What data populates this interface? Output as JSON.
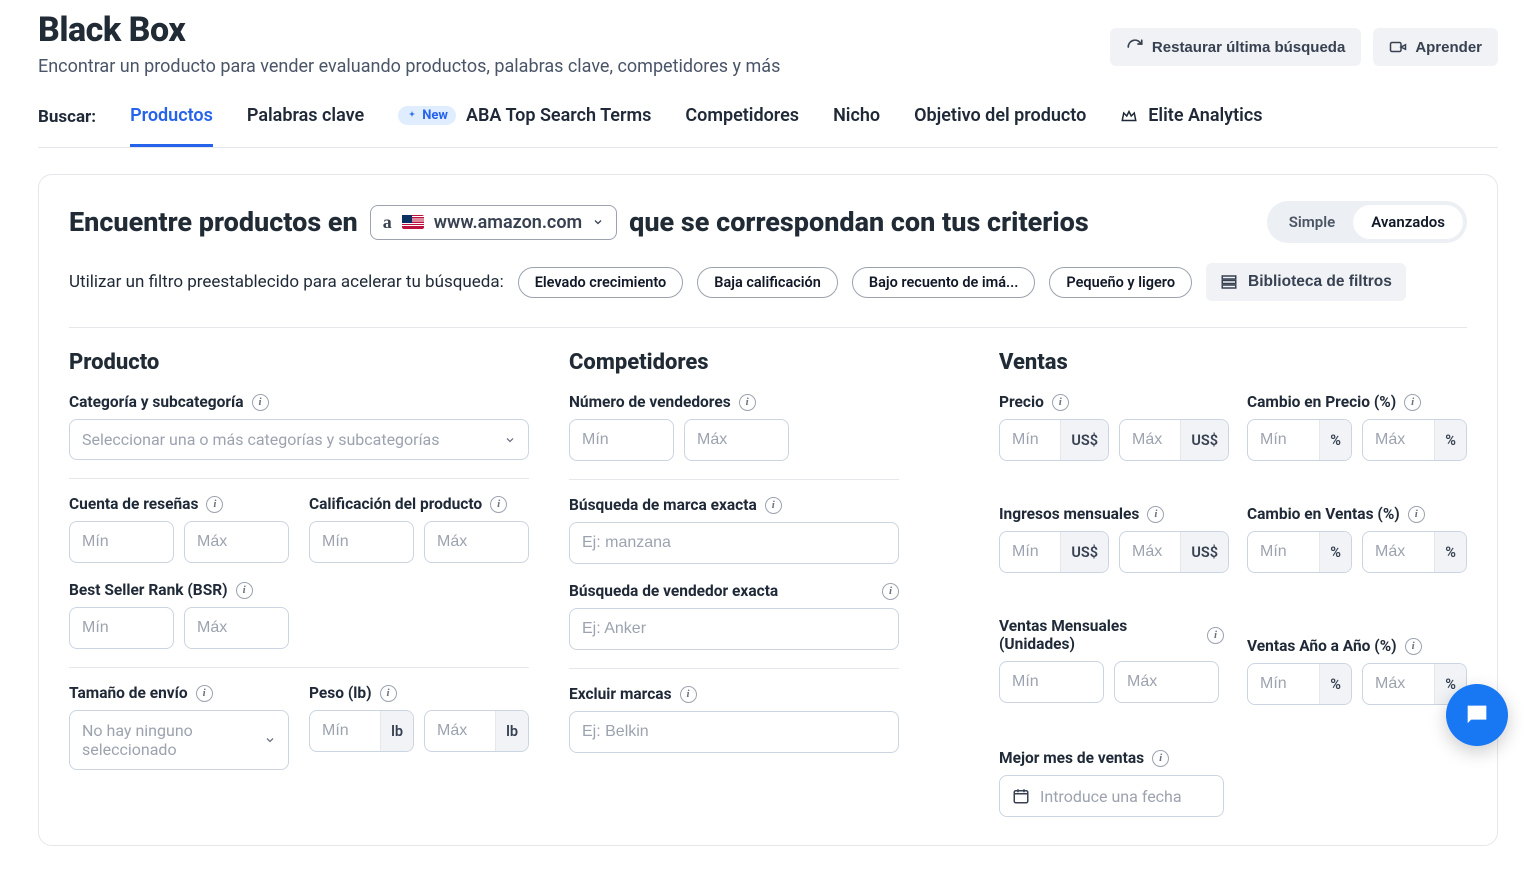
{
  "header": {
    "title": "Black Box",
    "subtitle": "Encontrar un producto para vender evaluando productos, palabras clave, competidores y más",
    "restore": "Restaurar última búsqueda",
    "learn": "Aprender"
  },
  "tabs": {
    "label": "Buscar:",
    "items": [
      {
        "label": "Productos",
        "active": true
      },
      {
        "label": "Palabras clave"
      },
      {
        "label": "ABA Top Search Terms",
        "new": true,
        "new_label": "New"
      },
      {
        "label": "Competidores"
      },
      {
        "label": "Nicho"
      },
      {
        "label": "Objetivo del producto"
      },
      {
        "label": "Elite Analytics",
        "crown": true
      }
    ]
  },
  "find": {
    "pre": "Encuentre productos en",
    "market": "www.amazon.com",
    "post": "que se correspondan con tus criterios",
    "mode_simple": "Simple",
    "mode_adv": "Avanzados"
  },
  "presets": {
    "text": "Utilizar un filtro preestablecido para acelerar tu búsqueda:",
    "chips": [
      "Elevado crecimiento",
      "Baja calificación",
      "Bajo recuento de imá...",
      "Pequeño y ligero"
    ],
    "library": "Biblioteca de filtros"
  },
  "sections": {
    "producto": {
      "title": "Producto",
      "category_label": "Categoría y subcategoría",
      "category_placeholder": "Seleccionar una o más categorías y subcategorías",
      "reviews_label": "Cuenta de reseñas",
      "rating_label": "Calificación del producto",
      "bsr_label": "Best Seller Rank (BSR)",
      "ship_label": "Tamaño de envío",
      "ship_placeholder": "No hay ninguno seleccionado",
      "weight_label": "Peso (lb)",
      "min": "Mín",
      "max": "Máx",
      "lb": "lb"
    },
    "competidores": {
      "title": "Competidores",
      "sellers_label": "Número de vendedores",
      "brand_label": "Búsqueda de marca exacta",
      "brand_ph": "Ej: manzana",
      "seller_search_label": "Búsqueda de vendedor exacta",
      "seller_ph": "Ej: Anker",
      "exclude_label": "Excluir marcas",
      "exclude_ph": "Ej: Belkin",
      "min": "Mín",
      "max": "Máx"
    },
    "ventas": {
      "title": "Ventas",
      "price_label": "Precio",
      "price_change_label": "Cambio en Precio (%)",
      "rev_label": "Ingresos mensuales",
      "sales_change_label": "Cambio en Ventas (%)",
      "units_label": "Ventas Mensuales (Unidades)",
      "yoy_label": "Ventas Año a Año (%)",
      "best_month_label": "Mejor mes de ventas",
      "date_ph": "Introduce una fecha",
      "min": "Mín",
      "max": "Máx",
      "usd": "US$",
      "pct": "%"
    }
  }
}
